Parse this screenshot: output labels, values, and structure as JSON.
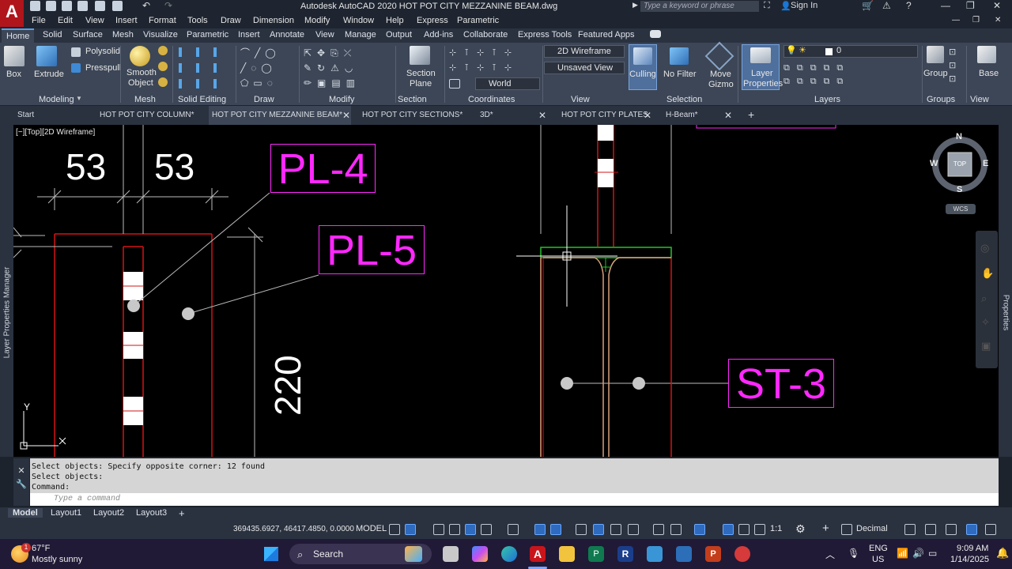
{
  "window": {
    "logo": "A",
    "title": "Autodesk AutoCAD 2020    HOT POT CITY MEZZANINE BEAM.dwg",
    "search_placeholder": "Type a keyword or phrase",
    "sign_in": "Sign In"
  },
  "menubar": [
    "File",
    "Edit",
    "View",
    "Insert",
    "Format",
    "Tools",
    "Draw",
    "Dimension",
    "Modify",
    "Window",
    "Help",
    "Express",
    "Parametric"
  ],
  "ribbon_tabs": [
    "Home",
    "Solid",
    "Surface",
    "Mesh",
    "Visualize",
    "Parametric",
    "Insert",
    "Annotate",
    "View",
    "Manage",
    "Output",
    "Add-ins",
    "Collaborate",
    "Express Tools",
    "Featured Apps"
  ],
  "ribbon": {
    "box": "Box",
    "extrude": "Extrude",
    "polysolid": "Polysolid",
    "presspull": "Presspull",
    "smooth_object": [
      "Smooth",
      "Object"
    ],
    "section_plane": [
      "Section",
      "Plane"
    ],
    "visual_style": "2D Wireframe",
    "view_name": "Unsaved View",
    "ucs": "World",
    "culling": "Culling",
    "no_filter": "No Filter",
    "move_gizmo": [
      "Move",
      "Gizmo"
    ],
    "layer_properties": [
      "Layer",
      "Properties"
    ],
    "current_layer": "0",
    "group": "Group",
    "base": "Base",
    "panels": [
      "Modeling",
      "Mesh",
      "Solid Editing",
      "Draw",
      "Modify",
      "Section",
      "Coordinates",
      "View",
      "Selection",
      "Layers",
      "Groups",
      "View"
    ]
  },
  "file_tabs": [
    "Start",
    "HOT POT CITY COLUMN*",
    "HOT POT CITY MEZZANINE BEAM*",
    "HOT POT CITY SECTIONS*",
    "3D*",
    "HOT POT CITY PLATES",
    "H-Beam*"
  ],
  "viewport": {
    "label": "[−][Top][2D Wireframe]",
    "dims": [
      "53",
      "53",
      "220"
    ],
    "tags": [
      "PL-4",
      "PL-5",
      "ST-3"
    ],
    "viewcube": {
      "n": "N",
      "s": "S",
      "e": "E",
      "w": "W",
      "top": "TOP",
      "wcs": "WCS"
    },
    "ucs_x": "X",
    "ucs_y": "Y",
    "colors": {
      "tag": "#ff28ff",
      "line_red": "#d21414",
      "line_green": "#25c12a",
      "beam_tan": "#d9a07a"
    }
  },
  "side_panels": {
    "left": "Layer Properties Manager",
    "right": "Properties"
  },
  "command": {
    "history": [
      "Select objects: Specify opposite corner: 12 found",
      "Select objects:",
      "Command:"
    ],
    "placeholder": "Type a command"
  },
  "layout_tabs": [
    "Model",
    "Layout1",
    "Layout2",
    "Layout3"
  ],
  "status": {
    "coords": "369435.6927, 46417.4850, 0.0000",
    "model": "MODEL",
    "scale": "1:1",
    "units": "Decimal"
  },
  "taskbar": {
    "temp": "67°F",
    "weather": "Mostly sunny",
    "badge": "1",
    "search": "Search",
    "lang1": "ENG",
    "lang2": "US",
    "time": "9:09 AM",
    "date": "1/14/2025"
  }
}
